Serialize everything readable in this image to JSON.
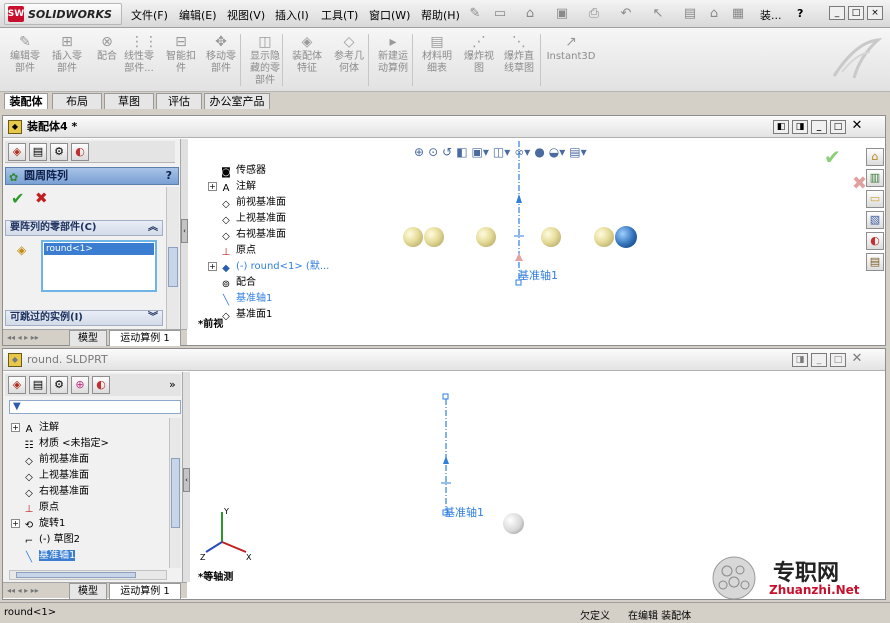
{
  "app": {
    "logo_text": "SOLIDWORKS",
    "menus": [
      "文件(F)",
      "编辑(E)",
      "视图(V)",
      "插入(I)",
      "工具(T)",
      "窗口(W)",
      "帮助(H)"
    ],
    "search_text": "装...",
    "help_icon": "question-icon"
  },
  "commands": [
    {
      "label": "编辑零\n部件",
      "icon": "edit-component-icon"
    },
    {
      "label": "插入零\n部件",
      "icon": "insert-component-icon"
    },
    {
      "label": "配合",
      "icon": "mate-icon"
    },
    {
      "label": "线性零\n部件...",
      "icon": "linear-pattern-icon"
    },
    {
      "label": "智能扣\n件",
      "icon": "smart-fastener-icon"
    },
    {
      "label": "移动零\n部件",
      "icon": "move-component-icon"
    },
    {
      "label": "显示隐\n藏的零\n部件",
      "icon": "show-hidden-icon"
    },
    {
      "label": "装配体\n特征",
      "icon": "assembly-feature-icon"
    },
    {
      "label": "参考几\n何体",
      "icon": "reference-geometry-icon"
    },
    {
      "label": "新建运\n动算例",
      "icon": "motion-study-icon"
    },
    {
      "label": "材料明\n细表",
      "icon": "bom-icon"
    },
    {
      "label": "爆炸视\n图",
      "icon": "explode-view-icon"
    },
    {
      "label": "爆炸直\n线草图",
      "icon": "explode-line-icon"
    },
    {
      "label": "Instant3D",
      "icon": "instant3d-icon"
    }
  ],
  "tabs": [
    "装配体",
    "布局",
    "草图",
    "评估",
    "办公室产品"
  ],
  "assembly_window": {
    "title": "装配体4 *",
    "feature_name": "圆周阵列",
    "help": "?",
    "section_components": "要阵列的零部件(C)",
    "selected_component": "round<1>",
    "section_skip": "可跳过的实例(I)",
    "tree": [
      {
        "label": "传感器",
        "icon": "sensor-icon",
        "expand": ""
      },
      {
        "label": "注解",
        "icon": "annotation-icon",
        "expand": "+"
      },
      {
        "label": "前视基准面",
        "icon": "plane-icon",
        "expand": ""
      },
      {
        "label": "上视基准面",
        "icon": "plane-icon",
        "expand": ""
      },
      {
        "label": "右视基准面",
        "icon": "plane-icon",
        "expand": ""
      },
      {
        "label": "原点",
        "icon": "origin-icon",
        "expand": ""
      },
      {
        "label": "(-) round<1> (默...",
        "icon": "part-icon",
        "expand": "+"
      },
      {
        "label": "配合",
        "icon": "mates-icon",
        "expand": ""
      },
      {
        "label": "基准轴1",
        "icon": "axis-icon",
        "expand": ""
      },
      {
        "label": "基准面1",
        "icon": "plane-icon",
        "expand": ""
      }
    ],
    "axis_label": "基准轴1",
    "view_label": "*前视",
    "bottom_tabs": [
      "模型",
      "运动算例 1"
    ]
  },
  "part_window": {
    "title": "round. SLDPRT",
    "tree": [
      {
        "label": "注解",
        "icon": "annotation-icon",
        "expand": "+"
      },
      {
        "label": "材质 <未指定>",
        "icon": "material-icon",
        "expand": ""
      },
      {
        "label": "前视基准面",
        "icon": "plane-icon",
        "expand": ""
      },
      {
        "label": "上视基准面",
        "icon": "plane-icon",
        "expand": ""
      },
      {
        "label": "右视基准面",
        "icon": "plane-icon",
        "expand": ""
      },
      {
        "label": "原点",
        "icon": "origin-icon",
        "expand": ""
      },
      {
        "label": "旋转1",
        "icon": "revolve-icon",
        "expand": "+"
      },
      {
        "label": "(-) 草图2",
        "icon": "sketch-icon",
        "expand": ""
      },
      {
        "label": "基准轴1",
        "icon": "axis-icon",
        "expand": ""
      }
    ],
    "axis_label": "基准轴1",
    "view_label": "*等轴测",
    "triad": {
      "x": "X",
      "y": "Y",
      "z": "Z"
    },
    "bottom_tabs": [
      "模型",
      "运动算例 1"
    ]
  },
  "status": {
    "left": "round<1>",
    "state": "欠定义",
    "editing": "在编辑 装配体"
  },
  "watermark": {
    "text": "专职网",
    "url": "Zhuanzhi.Net"
  },
  "colors": {
    "accent": "#2a5db0",
    "axis": "#2f7ee0",
    "red": "#c8102e"
  }
}
